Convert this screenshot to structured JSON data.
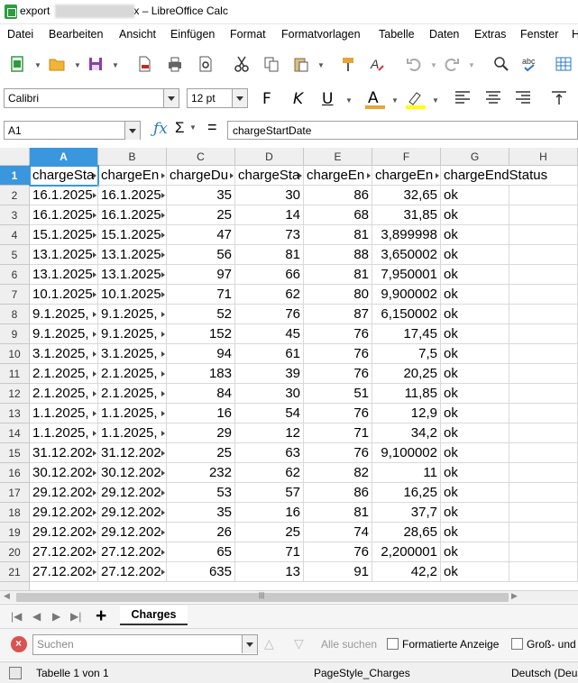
{
  "window": {
    "title_prefix": "export",
    "title_suffix": ".xlsx – LibreOffice Calc"
  },
  "menu": [
    "Datei",
    "Bearbeiten",
    "Ansicht",
    "Einfügen",
    "Format",
    "Formatvorlagen",
    "Tabelle",
    "Daten",
    "Extras",
    "Fenster",
    "H"
  ],
  "font": {
    "name": "Calibri",
    "size": "12 pt"
  },
  "format_buttons": {
    "bold": "F",
    "italic": "K",
    "underline": "U"
  },
  "namebox": "A1",
  "formula": "chargeStartDate",
  "columns": [
    "A",
    "B",
    "C",
    "D",
    "E",
    "F",
    "G",
    "H"
  ],
  "rows": [
    {
      "n": "1",
      "a": "chargeSta",
      "b": "chargeEn",
      "c": "chargeDu",
      "d": "chargeSta",
      "e": "chargeEn",
      "f": "chargeEn",
      "g": "chargeEndStatus"
    },
    {
      "n": "2",
      "a": "16.1.2025",
      "b": "16.1.2025",
      "c": "35",
      "d": "30",
      "e": "86",
      "f": "32,65",
      "g": "ok"
    },
    {
      "n": "3",
      "a": "16.1.2025",
      "b": "16.1.2025",
      "c": "25",
      "d": "14",
      "e": "68",
      "f": "31,85",
      "g": "ok"
    },
    {
      "n": "4",
      "a": "15.1.2025",
      "b": "15.1.2025",
      "c": "47",
      "d": "73",
      "e": "81",
      "f": "3,899998",
      "g": "ok"
    },
    {
      "n": "5",
      "a": "13.1.2025",
      "b": "13.1.2025",
      "c": "56",
      "d": "81",
      "e": "88",
      "f": "3,650002",
      "g": "ok"
    },
    {
      "n": "6",
      "a": "13.1.2025",
      "b": "13.1.2025",
      "c": "97",
      "d": "66",
      "e": "81",
      "f": "7,950001",
      "g": "ok"
    },
    {
      "n": "7",
      "a": "10.1.2025",
      "b": "10.1.2025",
      "c": "71",
      "d": "62",
      "e": "80",
      "f": "9,900002",
      "g": "ok"
    },
    {
      "n": "8",
      "a": "9.1.2025,",
      "b": "9.1.2025,",
      "c": "52",
      "d": "76",
      "e": "87",
      "f": "6,150002",
      "g": "ok"
    },
    {
      "n": "9",
      "a": "9.1.2025,",
      "b": "9.1.2025,",
      "c": "152",
      "d": "45",
      "e": "76",
      "f": "17,45",
      "g": "ok"
    },
    {
      "n": "10",
      "a": "3.1.2025,",
      "b": "3.1.2025,",
      "c": "94",
      "d": "61",
      "e": "76",
      "f": "7,5",
      "g": "ok"
    },
    {
      "n": "11",
      "a": "2.1.2025,",
      "b": "2.1.2025,",
      "c": "183",
      "d": "39",
      "e": "76",
      "f": "20,25",
      "g": "ok"
    },
    {
      "n": "12",
      "a": "2.1.2025,",
      "b": "2.1.2025,",
      "c": "84",
      "d": "30",
      "e": "51",
      "f": "11,85",
      "g": "ok"
    },
    {
      "n": "13",
      "a": "1.1.2025,",
      "b": "1.1.2025,",
      "c": "16",
      "d": "54",
      "e": "76",
      "f": "12,9",
      "g": "ok"
    },
    {
      "n": "14",
      "a": "1.1.2025,",
      "b": "1.1.2025,",
      "c": "29",
      "d": "12",
      "e": "71",
      "f": "34,2",
      "g": "ok"
    },
    {
      "n": "15",
      "a": "31.12.202",
      "b": "31.12.202",
      "c": "25",
      "d": "63",
      "e": "76",
      "f": "9,100002",
      "g": "ok"
    },
    {
      "n": "16",
      "a": "30.12.202",
      "b": "30.12.202",
      "c": "232",
      "d": "62",
      "e": "82",
      "f": "11",
      "g": "ok"
    },
    {
      "n": "17",
      "a": "29.12.202",
      "b": "29.12.202",
      "c": "53",
      "d": "57",
      "e": "86",
      "f": "16,25",
      "g": "ok"
    },
    {
      "n": "18",
      "a": "29.12.202",
      "b": "29.12.202",
      "c": "35",
      "d": "16",
      "e": "81",
      "f": "37,7",
      "g": "ok"
    },
    {
      "n": "19",
      "a": "29.12.202",
      "b": "29.12.202",
      "c": "26",
      "d": "25",
      "e": "74",
      "f": "28,65",
      "g": "ok"
    },
    {
      "n": "20",
      "a": "27.12.202",
      "b": "27.12.202",
      "c": "65",
      "d": "71",
      "e": "76",
      "f": "2,200001",
      "g": "ok"
    },
    {
      "n": "21",
      "a": "27.12.202",
      "b": "27.12.202",
      "c": "635",
      "d": "13",
      "e": "91",
      "f": "42,2",
      "g": "ok"
    }
  ],
  "sheet_tab": "Charges",
  "find": {
    "placeholder": "Suchen",
    "find_all": "Alle suchen",
    "formatted": "Formatierte Anzeige",
    "case": "Groß- und"
  },
  "status": {
    "sheet": "Tabelle 1 von 1",
    "page_style": "PageStyle_Charges",
    "language": "Deutsch (Deu"
  }
}
